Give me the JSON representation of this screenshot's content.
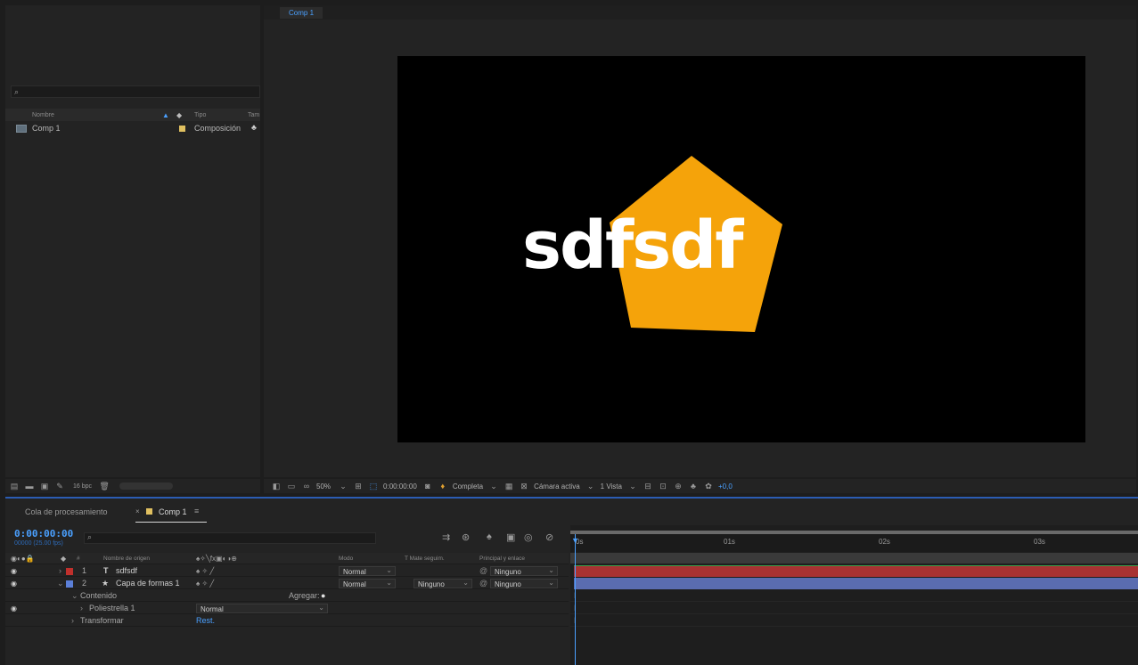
{
  "project": {
    "search_icon": "search-icon",
    "columns": {
      "name": "Nombre",
      "type": "Tipo",
      "size": "Tam"
    },
    "items": [
      {
        "name": "Comp 1",
        "type": "Composición",
        "label_color": "#e0c060"
      }
    ],
    "bit_depth": "16 bpc"
  },
  "viewer": {
    "tab": "Comp 1",
    "canvas_text": "sdfsdf",
    "shape_color": "#f5a30a",
    "zoom": "50%",
    "timecode": "0:00:00:00",
    "resolution": "Completa",
    "camera": "Cámara activa",
    "views": "1 Vista",
    "exposure": "+0,0"
  },
  "timeline": {
    "tabs": {
      "render_queue": "Cola de procesamiento",
      "comp": "Comp 1"
    },
    "timecode": "0:00:00:00",
    "fps": "00000 (25.00 fps)",
    "columns": {
      "number": "#",
      "source_name": "Nombre de origen",
      "mode": "Modo",
      "track_matte": "T  Mate seguim.",
      "parent": "Principal y enlace"
    },
    "layers": [
      {
        "num": "1",
        "type_icon": "T",
        "name": "sdfsdf",
        "label_color": "#c0302c",
        "mode": "Normal",
        "matte": "",
        "parent": "Ninguno",
        "bar_color": "#a83232"
      },
      {
        "num": "2",
        "type_icon": "★",
        "name": "Capa de formas 1",
        "label_color": "#5b7fd8",
        "mode": "Normal",
        "matte": "Ninguno",
        "parent": "Ninguno",
        "bar_color": "#5a6cb0"
      }
    ],
    "contents_label": "Contenido",
    "add_label": "Agregar:",
    "polystar": "Poliestrella 1",
    "polystar_mode": "Normal",
    "transform": "Transformar",
    "reset": "Rest.",
    "ruler": [
      "0s",
      "01s",
      "02s",
      "03s"
    ]
  }
}
